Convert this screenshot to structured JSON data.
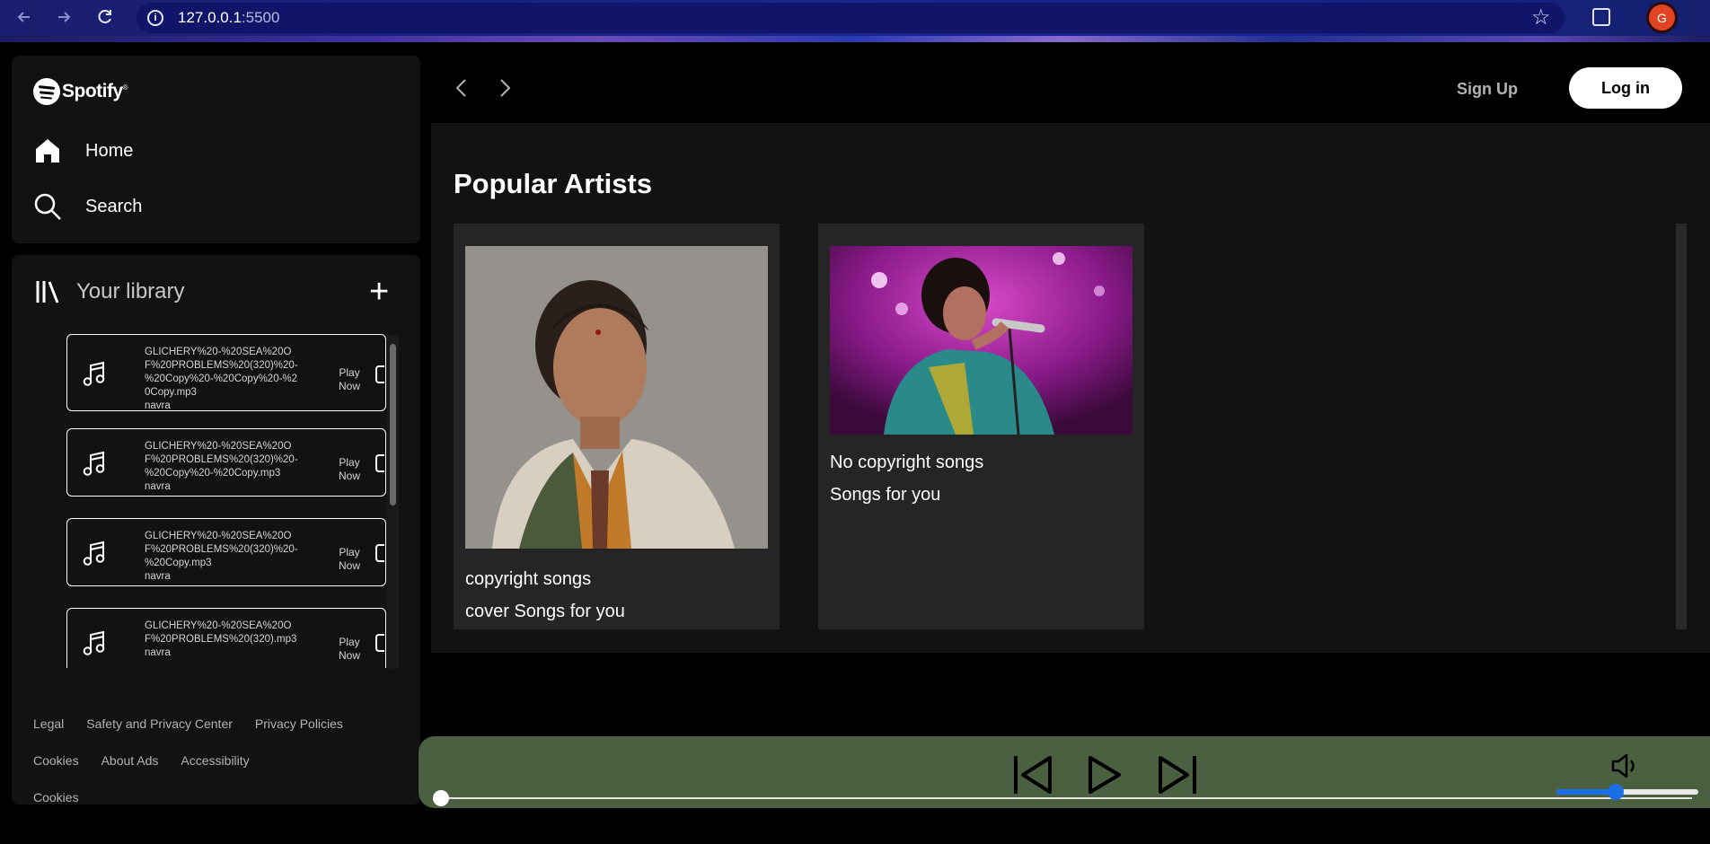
{
  "browser": {
    "url_host": "127.0.0.1",
    "url_port": ":5500",
    "info_glyph": "i",
    "profile_initial": "G"
  },
  "sidebar": {
    "brand": "Spotify",
    "brand_mark": "®",
    "nav": [
      {
        "label": "Home",
        "icon": "home-icon"
      },
      {
        "label": "Search",
        "icon": "search-icon"
      }
    ],
    "library": {
      "title": "Your library",
      "add_label": "+",
      "songs": [
        {
          "title": "GLICHERY%20-%20SEA%20OF%20PROBLEMS%20(320)%20-%20Copy%20-%20Copy%20-%20Copy.mp3",
          "artist": "navra",
          "play": "Play Now"
        },
        {
          "title": "GLICHERY%20-%20SEA%20OF%20PROBLEMS%20(320)%20-%20Copy%20-%20Copy.mp3",
          "artist": "navra",
          "play": "Play Now"
        },
        {
          "title": "GLICHERY%20-%20SEA%20OF%20PROBLEMS%20(320)%20-%20Copy.mp3",
          "artist": "navra",
          "play": "Play Now"
        },
        {
          "title": "GLICHERY%20-%20SEA%20OF%20PROBLEMS%20(320).mp3",
          "artist": "navra",
          "play": "Play Now"
        }
      ]
    },
    "footer": {
      "row1": [
        "Legal",
        "Safety and Privacy Center",
        "Privacy Policies"
      ],
      "row2": [
        "Cookies",
        "About Ads",
        "Accessibility"
      ],
      "row3": [
        "Cookies"
      ]
    }
  },
  "header": {
    "signup": "Sign Up",
    "login": "Log in"
  },
  "main": {
    "section_title": "Popular Artists",
    "cards": [
      {
        "title": "copyright songs",
        "subtitle": "cover Songs for you"
      },
      {
        "title": "No copyright songs",
        "subtitle": "Songs for you"
      }
    ]
  },
  "player": {
    "progress_fraction": 0.0,
    "volume_fraction": 0.42,
    "accent": "#1a6ee8",
    "background": "#4a6041"
  }
}
